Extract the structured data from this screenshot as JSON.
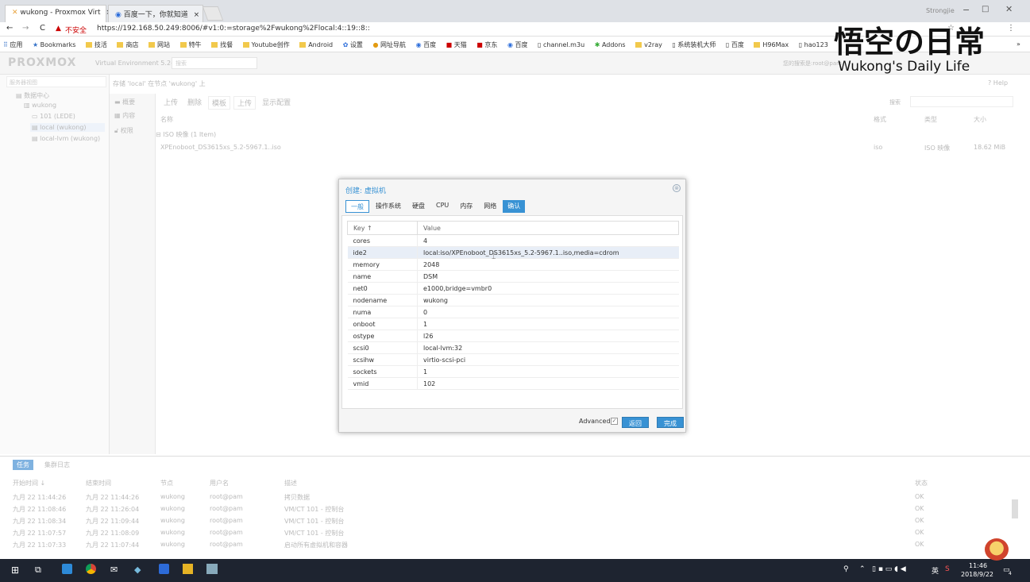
{
  "browser": {
    "tabs": [
      {
        "title": "wukong - Proxmox Virt",
        "close": "×"
      },
      {
        "title": "百度一下，你就知道",
        "close": "×"
      }
    ],
    "profile": "Strongjie",
    "nav": {
      "back": "←",
      "forward": "→",
      "reload": "C"
    },
    "insecure_label": "不安全",
    "url": "https://192.168.50.249:8006/#v1:0:=storage%2Fwukong%2Flocal:4::19::8::",
    "bookmarks": [
      "应用",
      "Bookmarks",
      "技活",
      "商店",
      "网站",
      "特牛",
      "找餐",
      "Youtube创作",
      "Android",
      "设置",
      "网址导航",
      "百度",
      "天猫",
      "京东",
      "百度",
      "channel.m3u",
      "Addons",
      "v2ray",
      "系统装机大师",
      "百度",
      "H96Max",
      "hao123"
    ],
    "bookmarks_more": "»"
  },
  "pve": {
    "logo": "PROXMOX",
    "version": "Virtual Environment 5.2-1",
    "search_placeholder": "搜索",
    "user_text": "您的搜索是:root@pam",
    "server_view": "服务器视图",
    "tree": [
      {
        "label": "数据中心"
      },
      {
        "label": "wukong"
      },
      {
        "label": "101 (LEDE)"
      },
      {
        "label": "local (wukong)"
      },
      {
        "label": "local-lvm (wukong)"
      }
    ],
    "content_title": "存储 'local' 在节点 'wukong' 上",
    "help": "Help",
    "submenu": [
      "概要",
      "内容",
      "权限"
    ],
    "toolbar": [
      "上传",
      "删除",
      "模板",
      "上传",
      "显示配置"
    ],
    "search_label": "搜索",
    "columns": [
      "名称",
      "格式",
      "类型",
      "大小"
    ],
    "group_label": "ISO 映像 (1 Item)",
    "file": {
      "name": "XPEnoboot_DS3615xs_5.2-5967.1..iso",
      "format": "iso",
      "type": "ISO 映像",
      "size": "18.62 MiB"
    }
  },
  "modal": {
    "title": "创建: 虚拟机",
    "close": "⊗",
    "tabs": [
      "一般",
      "操作系统",
      "硬盘",
      "CPU",
      "内存",
      "网络",
      "确认"
    ],
    "headers": {
      "key": "Key ↑",
      "value": "Value"
    },
    "rows": [
      {
        "key": "cores",
        "value": "4"
      },
      {
        "key": "ide2",
        "value": "local:iso/XPEnoboot_DS3615xs_5.2-5967.1..iso,media=cdrom"
      },
      {
        "key": "memory",
        "value": "2048"
      },
      {
        "key": "name",
        "value": "DSM"
      },
      {
        "key": "net0",
        "value": "e1000,bridge=vmbr0"
      },
      {
        "key": "nodename",
        "value": "wukong"
      },
      {
        "key": "numa",
        "value": "0"
      },
      {
        "key": "onboot",
        "value": "1"
      },
      {
        "key": "ostype",
        "value": "l26"
      },
      {
        "key": "scsi0",
        "value": "local-lvm:32"
      },
      {
        "key": "scsihw",
        "value": "virtio-scsi-pci"
      },
      {
        "key": "sockets",
        "value": "1"
      },
      {
        "key": "vmid",
        "value": "102"
      }
    ],
    "advanced": "Advanced",
    "back": "返回",
    "finish": "完成"
  },
  "log": {
    "tabs": [
      "任务",
      "集群日志"
    ],
    "columns": [
      "开始时间 ↓",
      "结束时间",
      "节点",
      "用户名",
      "描述",
      "状态"
    ],
    "rows": [
      {
        "start": "九月 22 11:44:26",
        "end": "九月 22 11:44:26",
        "node": "wukong",
        "user": "root@pam",
        "desc": "拷贝数据",
        "status": "OK"
      },
      {
        "start": "九月 22 11:08:46",
        "end": "九月 22 11:26:04",
        "node": "wukong",
        "user": "root@pam",
        "desc": "VM/CT 101 - 控制台",
        "status": "OK"
      },
      {
        "start": "九月 22 11:08:34",
        "end": "九月 22 11:09:44",
        "node": "wukong",
        "user": "root@pam",
        "desc": "VM/CT 101 - 控制台",
        "status": "OK"
      },
      {
        "start": "九月 22 11:07:57",
        "end": "九月 22 11:08:09",
        "node": "wukong",
        "user": "root@pam",
        "desc": "VM/CT 101 - 控制台",
        "status": "OK"
      },
      {
        "start": "九月 22 11:07:33",
        "end": "九月 22 11:07:44",
        "node": "wukong",
        "user": "root@pam",
        "desc": "启动所有虚拟机和容器",
        "status": "OK"
      }
    ]
  },
  "watermark": {
    "title": "悟空の日常",
    "subtitle": "Wukong's Daily Life"
  },
  "taskbar": {
    "time": "11:46",
    "date": "2018/9/22",
    "lang": "英",
    "notif": "4"
  },
  "colors": {
    "accent": "#3892d4",
    "taskbar": "#1e2430"
  }
}
